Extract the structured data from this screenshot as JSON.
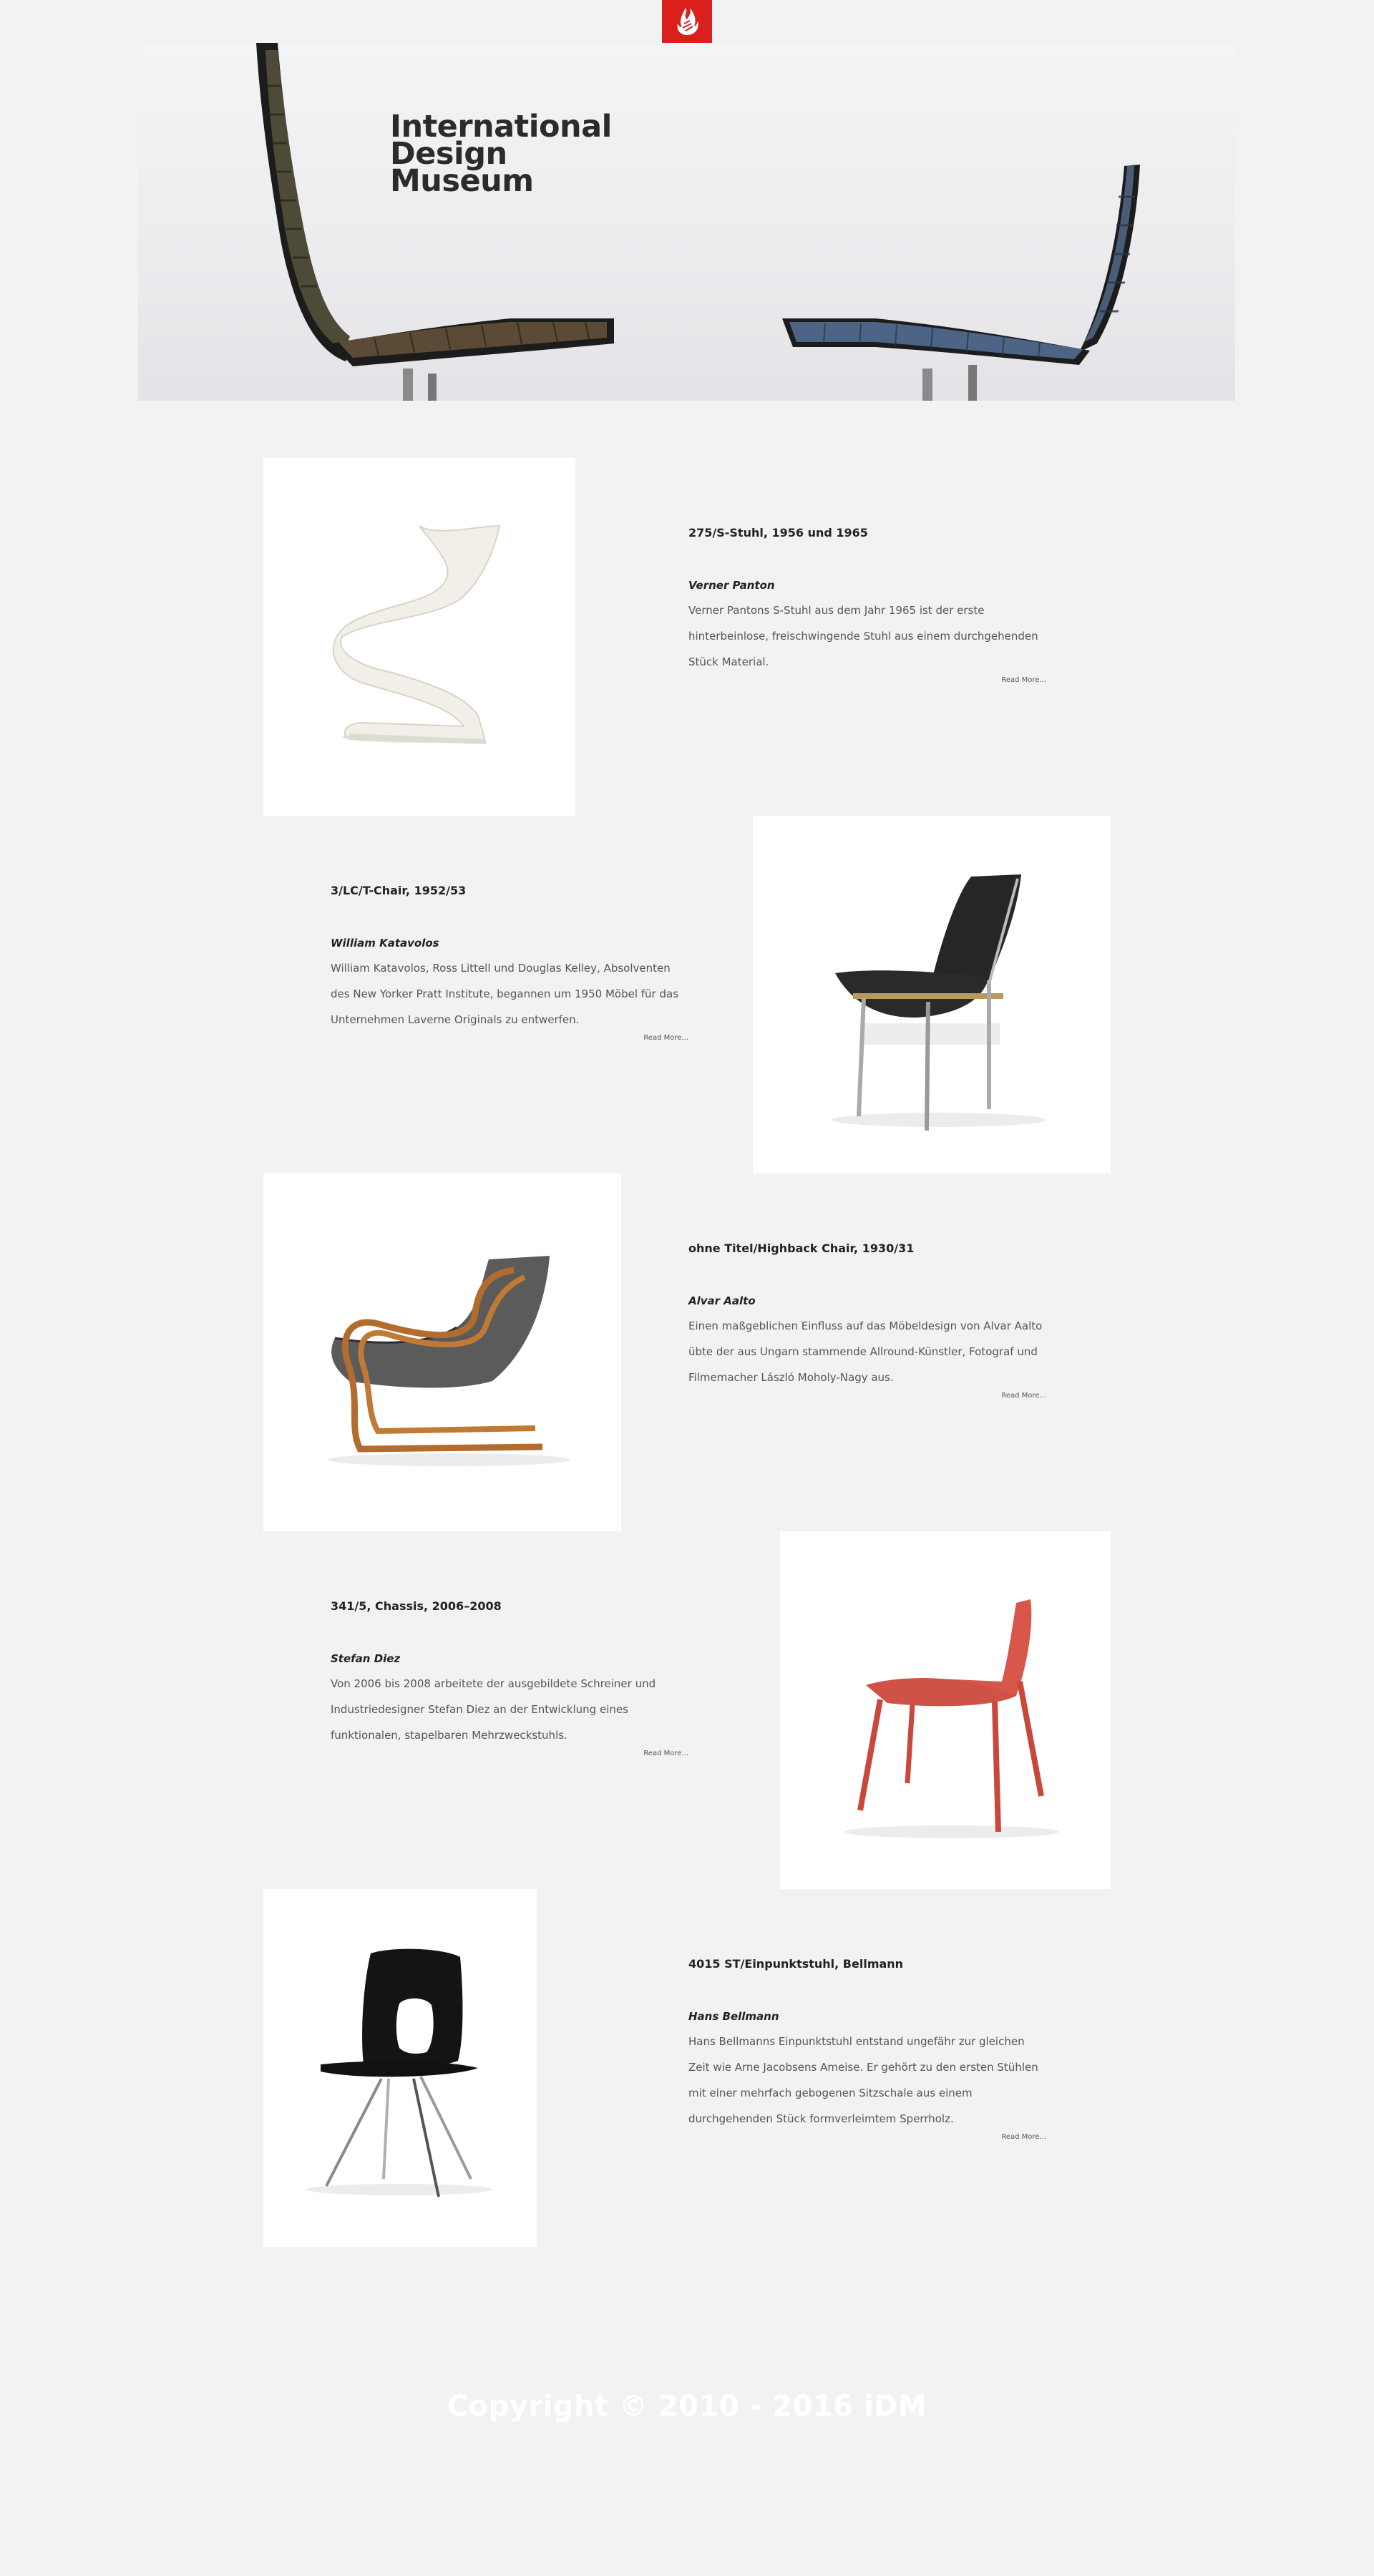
{
  "header": {
    "logo_icon": "flame-logo-icon",
    "brand_color": "#d9201c",
    "title_lines": [
      "International",
      "Design",
      "Museum"
    ]
  },
  "chairs": [
    {
      "title": "275/S-Stuhl, 1956 und 1965",
      "designer": "Verner Panton",
      "description": "Verner Pantons S-Stuhl aus dem Jahr 1965 ist der erste hinterbeinlose, freischwingende Stuhl aus einem durchgehenden Stück Material.",
      "read_more": "Read More..."
    },
    {
      "title": "3/LC/T-Chair, 1952/53",
      "designer": "William Katavolos",
      "description": "William Katavolos, Ross Littell und Douglas Kelley, Absolventen des New Yorker Pratt Institute, begannen um 1950 Möbel für das Unternehmen Laverne Originals zu entwerfen.",
      "read_more": "Read More..."
    },
    {
      "title": "ohne Titel/Highback Chair, 1930/31",
      "designer": "Alvar Aalto",
      "description": "Einen maßgeblichen Einfluss auf das Möbeldesign von Alvar Aalto übte der aus Ungarn stammende Allround-Künstler, Fotograf und Filmemacher László Moholy-Nagy aus.",
      "read_more": "Read More..."
    },
    {
      "title": "341/5, Chassis, 2006–2008",
      "designer": "Stefan Diez",
      "description": "Von 2006 bis 2008 arbeitete der ausgebildete Schreiner und Industriedesigner Stefan Diez an der Entwicklung eines funktionalen, stapelbaren Mehrzweckstuhls.",
      "read_more": "Read More..."
    },
    {
      "title": "4015 ST/Einpunktstuhl, Bellmann",
      "designer": "Hans Bellmann",
      "description": "Hans Bellmanns Einpunktstuhl entstand ungefähr zur gleichen Zeit wie Arne Jacobsens Ameise. Er gehört zu den ersten Stühlen mit einer mehrfach gebogenen Sitzschale aus einem durchgehenden Stück formverleimtem Sperrholz.",
      "read_more": "Read More..."
    }
  ],
  "footer": {
    "copyright": "Copyright © 2010 - 2016 iDM"
  }
}
